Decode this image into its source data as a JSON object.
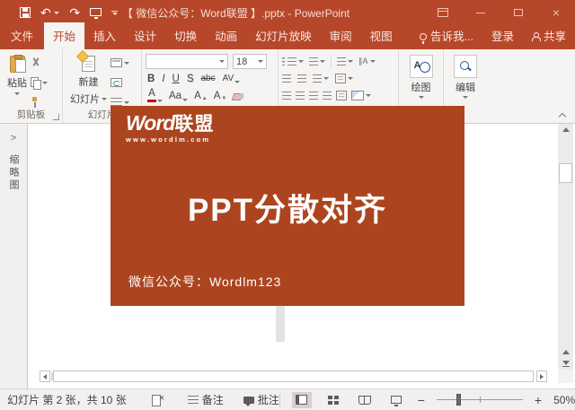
{
  "titlebar": {
    "title": "【 微信公众号：Word联盟 】.pptx - PowerPoint"
  },
  "tabs": {
    "file": "文件",
    "home": "开始",
    "insert": "插入",
    "design": "设计",
    "transitions": "切换",
    "animations": "动画",
    "slide_show": "幻灯片放映",
    "review": "审阅",
    "view": "视图",
    "tell_me": "告诉我...",
    "sign_in": "登录",
    "share": "共享"
  },
  "ribbon": {
    "paste": "粘贴",
    "clipboard_group": "剪贴板",
    "new_slide_line1": "新建",
    "new_slide_line2": "幻灯片",
    "slides_group": "幻灯片",
    "font_size": "18",
    "bold": "B",
    "italic": "I",
    "underline": "U",
    "shadow": "S",
    "strikethrough": "abc",
    "char_spacing": "AV",
    "font_color": "A",
    "change_case": "Aa",
    "grow_font": "A",
    "shrink_font": "A",
    "drawing": "绘图",
    "editing": "编辑"
  },
  "thumbnail_pane": {
    "label": "缩略图",
    "collapse_glyph": ">"
  },
  "slide": {
    "logo_word": "Word",
    "logo_suffix": "联盟",
    "logo_url": "www.wordlm.com",
    "title": "PPT分散对齐",
    "footer": "微信公众号：Wordlm123"
  },
  "statusbar": {
    "slide_info": "幻灯片 第 2 张，共 10 张",
    "notes": "备注",
    "comments": "批注",
    "zoom_level": "50%"
  },
  "colors": {
    "chrome_red": "#b7472a",
    "tab_active_text": "#b7472a",
    "slide_red": "#ac451f"
  }
}
